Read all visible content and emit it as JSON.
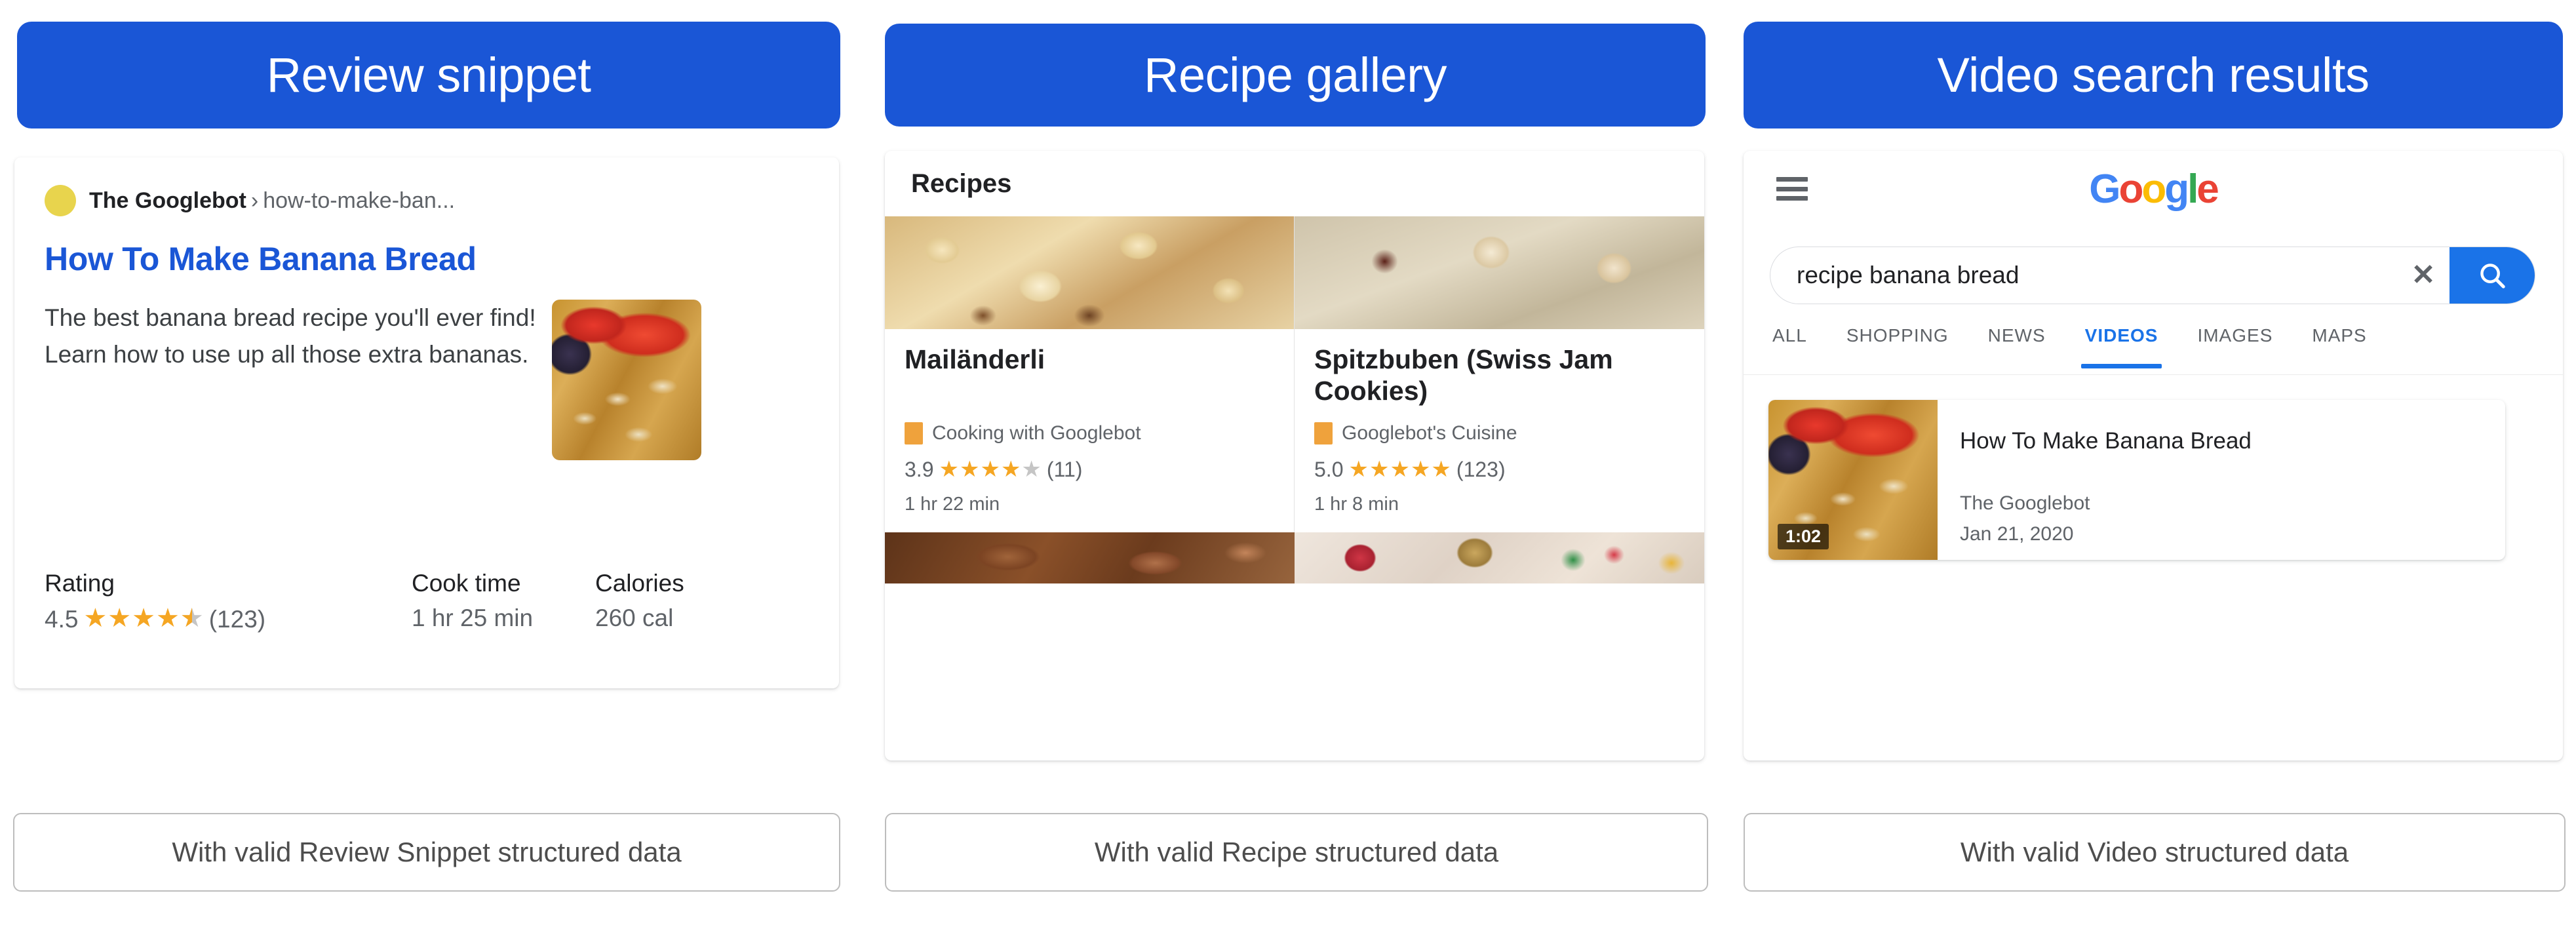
{
  "panels": [
    {
      "header": "Review snippet",
      "caption": "With valid Review Snippet structured data",
      "result": {
        "site": "The Googlebot",
        "separator": "›",
        "path": "how-to-make-ban...",
        "title": "How To Make Banana Bread",
        "description": "The best banana bread recipe you'll ever find! Learn how to use up all those extra bananas.",
        "thumbnail_alt": "banana-bread-thumbnail",
        "meta": [
          {
            "label": "Rating",
            "value": "4.5",
            "stars": 4.5,
            "count": "(123)"
          },
          {
            "label": "Cook time",
            "value": "1 hr 25 min"
          },
          {
            "label": "Calories",
            "value": "260 cal"
          }
        ]
      }
    },
    {
      "header": "Recipe gallery",
      "caption": "With valid Recipe structured data",
      "gallery": {
        "title": "Recipes",
        "cards": [
          {
            "name": "Mailänderli",
            "site": "Cooking with Googlebot",
            "rating": "3.9",
            "stars": 4,
            "count": "(11)",
            "time": "1 hr 22 min",
            "image_alt": "butter-cookies-image",
            "strip_alt": "chocolate-cookies-image"
          },
          {
            "name": "Spitzbuben (Swiss Jam Cookies)",
            "site": "Googlebot's Cuisine",
            "rating": "5.0",
            "stars": 5,
            "count": "(123)",
            "time": "1 hr 8 min",
            "image_alt": "jam-cookies-image",
            "strip_alt": "christmas-cookies-image"
          }
        ]
      }
    },
    {
      "header": "Video search results",
      "caption": "With valid Video structured data",
      "serp": {
        "logo": {
          "letters": [
            "G",
            "o",
            "o",
            "g",
            "l",
            "e"
          ]
        },
        "search": {
          "value": "recipe banana bread",
          "placeholder": "Search",
          "clear_label": "✕"
        },
        "tabs": [
          {
            "label": "ALL",
            "active": false
          },
          {
            "label": "SHOPPING",
            "active": false
          },
          {
            "label": "NEWS",
            "active": false
          },
          {
            "label": "VIDEOS",
            "active": true
          },
          {
            "label": "IMAGES",
            "active": false
          },
          {
            "label": "MAPS",
            "active": false
          }
        ],
        "video": {
          "title": "How To Make Banana Bread",
          "channel": "The Googlebot",
          "date": "Jan 21, 2020",
          "duration": "1:02",
          "thumbnail_alt": "banana-bread-video-thumbnail"
        }
      }
    }
  ],
  "colors": {
    "header_blue": "#1a56d6",
    "link_blue": "#1a56d6",
    "tab_active_blue": "#1a73e8",
    "star_gold": "#f5a623",
    "star_grey": "#c5c5c5",
    "favicon_yellow": "#e8d44d",
    "site_chip_orange": "#efa23c",
    "caption_border": "#bdbdbd",
    "text_primary": "#202124",
    "text_secondary": "#5f6368"
  }
}
